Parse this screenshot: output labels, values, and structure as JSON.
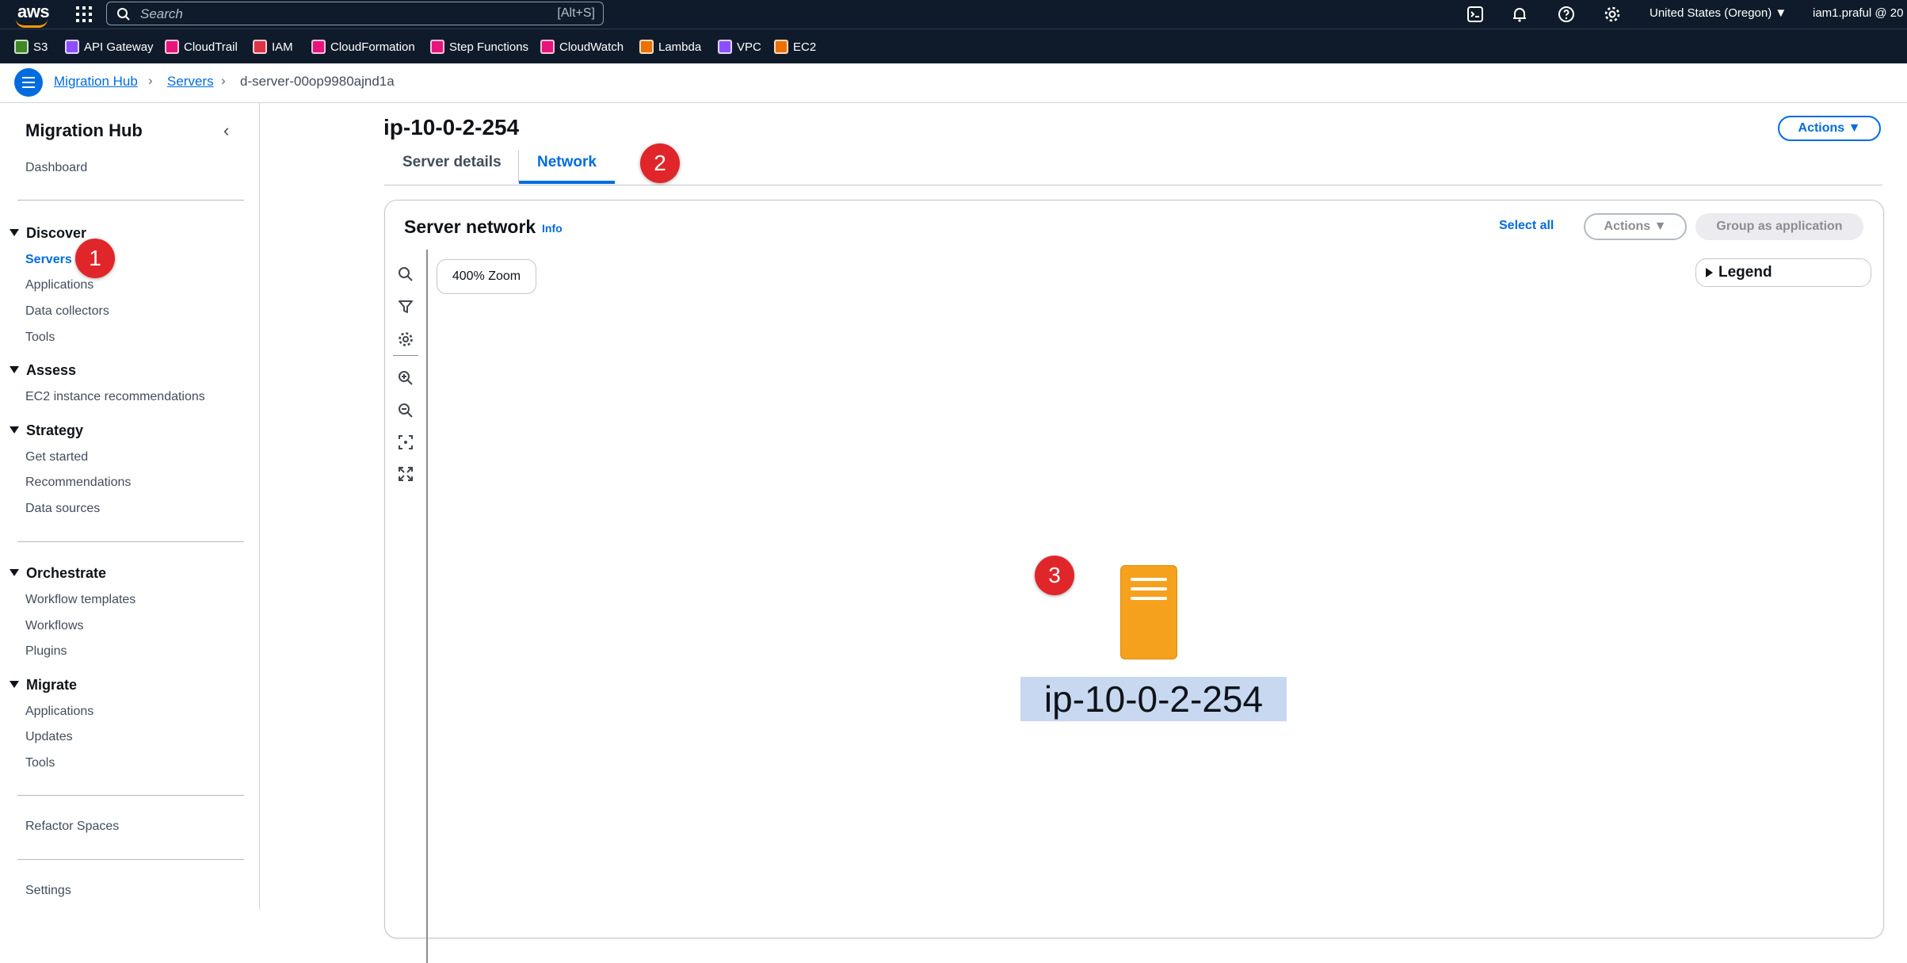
{
  "topbar": {
    "logo_text": "aws",
    "search_placeholder": "Search",
    "search_shortcut": "[Alt+S]",
    "region": "United States (Oregon) ▼",
    "user": "iam1.praful @ 20"
  },
  "favorites": [
    {
      "label": "S3",
      "color": "#3f8624"
    },
    {
      "label": "API Gateway",
      "color": "#8c4fff"
    },
    {
      "label": "CloudTrail",
      "color": "#e7157b"
    },
    {
      "label": "IAM",
      "color": "#dd344c"
    },
    {
      "label": "CloudFormation",
      "color": "#e7157b"
    },
    {
      "label": "Step Functions",
      "color": "#e7157b"
    },
    {
      "label": "CloudWatch",
      "color": "#e7157b"
    },
    {
      "label": "Lambda",
      "color": "#ed7100"
    },
    {
      "label": "VPC",
      "color": "#8c4fff"
    },
    {
      "label": "EC2",
      "color": "#ed7100"
    }
  ],
  "breadcrumb": {
    "items": [
      "Migration Hub",
      "Servers",
      "d-server-00op9980ajnd1a"
    ]
  },
  "sidebar": {
    "title": "Migration Hub",
    "dashboard": "Dashboard",
    "sections": [
      {
        "title": "Discover",
        "items": [
          "Servers",
          "Applications",
          "Data collectors",
          "Tools"
        ]
      },
      {
        "title": "Assess",
        "items": [
          "EC2 instance recommendations"
        ]
      },
      {
        "title": "Strategy",
        "items": [
          "Get started",
          "Recommendations",
          "Data sources"
        ]
      },
      {
        "title": "Orchestrate",
        "items": [
          "Workflow templates",
          "Workflows",
          "Plugins"
        ]
      },
      {
        "title": "Migrate",
        "items": [
          "Applications",
          "Updates",
          "Tools"
        ]
      }
    ],
    "refactor": "Refactor Spaces",
    "settings": "Settings"
  },
  "annotations": [
    "1",
    "2",
    "3"
  ],
  "page": {
    "title": "ip-10-0-2-254",
    "actions_label": "Actions",
    "tabs": [
      "Server details",
      "Network"
    ],
    "active_tab": "Network"
  },
  "panel": {
    "title": "Server network",
    "info": "Info",
    "select_all": "Select all",
    "actions_label": "Actions",
    "group_label": "Group as application",
    "zoom": "400% Zoom",
    "legend": "Legend",
    "node_label": "ip-10-0-2-254"
  },
  "colors": {
    "accent": "#006ce0",
    "topbar_bg": "#0f1b2a",
    "server_icon": "#f5a11e",
    "annotation_badge": "#e0262a",
    "node_label_highlight": "#c7d8f0"
  }
}
